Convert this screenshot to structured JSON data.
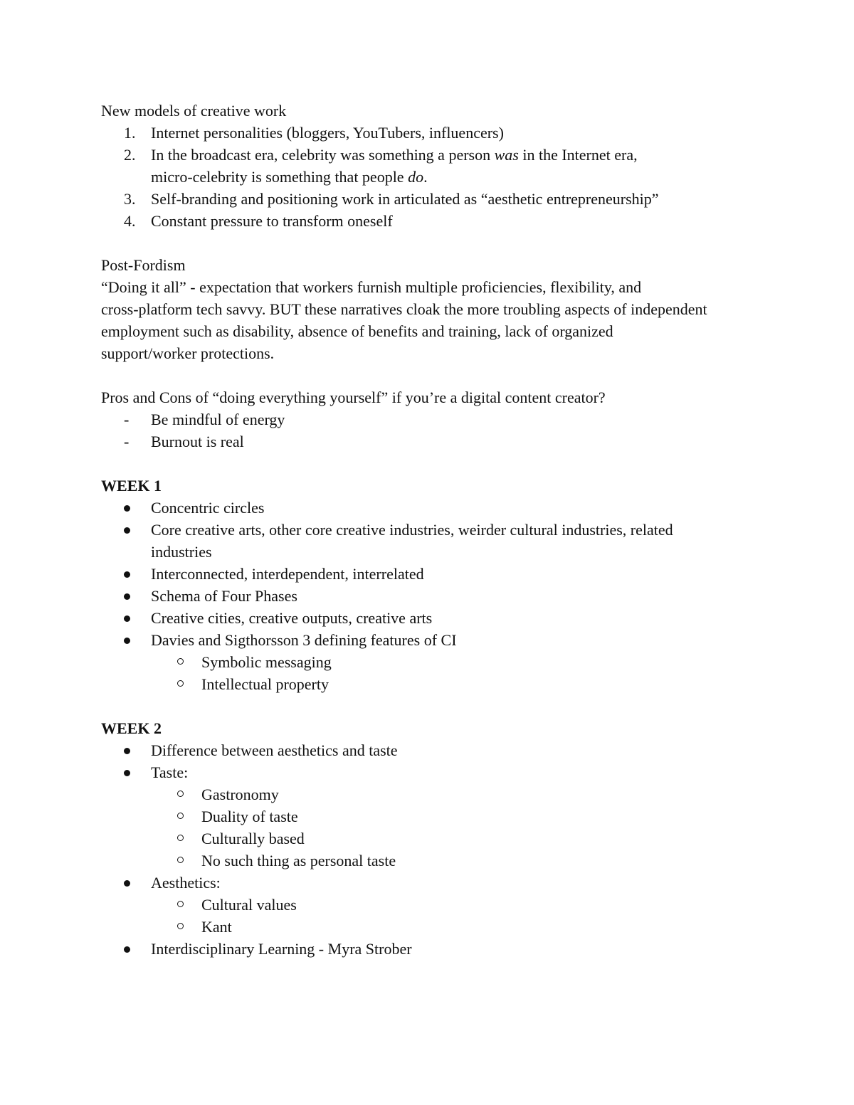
{
  "sections": {
    "creative_work": {
      "title": "New models of creative work",
      "items": [
        {
          "number": "1.",
          "text": "Internet personalities (bloggers, YouTubers, influencers)"
        },
        {
          "number": "2.",
          "text_before": "In the broadcast era, celebrity was something a person ",
          "text_em1": "was",
          "text_mid": " in the Internet era,",
          "text_line2": "micro-celebrity is something that people ",
          "text_em2": "do",
          "text_end": "."
        },
        {
          "number": "3.",
          "text": "Self-branding and positioning work in articulated as “aesthetic entrepreneurship”"
        },
        {
          "number": "4.",
          "text": "Constant pressure to transform oneself"
        }
      ]
    },
    "post_fordism": {
      "title": "Post-Fordism",
      "body_lines": [
        "“Doing it all” - expectation that workers furnish multiple proficiencies, flexibility, and",
        "cross-platform tech savvy. BUT these narratives cloak the more troubling aspects of independent",
        "employment such as disability, absence of benefits and training, lack of organized",
        "support/worker protections."
      ]
    },
    "pros_cons": {
      "title": "Pros and Cons of “doing everything yourself” if you’re a digital content creator?",
      "items": [
        {
          "marker": "-",
          "text": "Be mindful of energy"
        },
        {
          "marker": "-",
          "text": "Burnout is real"
        }
      ]
    },
    "week1": {
      "title": "WEEK 1",
      "items": [
        {
          "text": "Concentric circles"
        },
        {
          "text": "Core creative arts, other core creative industries, weirder cultural industries, related",
          "text_line2": "industries"
        },
        {
          "text": "Interconnected, interdependent, interrelated"
        },
        {
          "text": "Schema of Four Phases"
        },
        {
          "text": "Creative cities, creative outputs, creative arts"
        },
        {
          "text": "Davies and Sigthorsson 3 defining features of CI"
        }
      ],
      "subitems": [
        {
          "text": "Symbolic messaging"
        },
        {
          "text": "Intellectual property"
        }
      ]
    },
    "week2": {
      "title": "WEEK 2",
      "items": [
        {
          "text": "Difference between aesthetics and taste"
        },
        {
          "text": "Taste:"
        },
        {
          "text": "Aesthetics:"
        },
        {
          "text": "Interdisciplinary Learning - Myra Strober"
        }
      ],
      "taste_subitems": [
        {
          "text": "Gastronomy"
        },
        {
          "text": "Duality of taste"
        },
        {
          "text": "Culturally based"
        },
        {
          "text": "No such thing as personal taste"
        }
      ],
      "aesthetics_subitems": [
        {
          "text": "Cultural values"
        },
        {
          "text": "Kant"
        }
      ]
    }
  }
}
